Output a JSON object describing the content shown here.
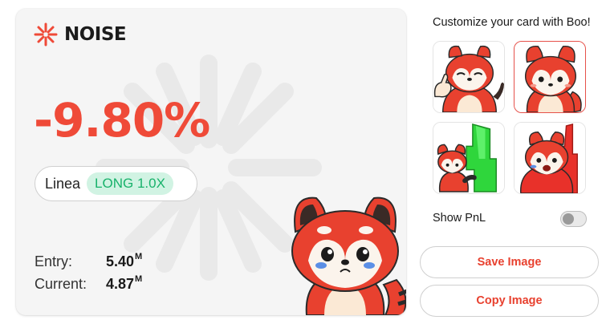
{
  "card": {
    "brand": "NOISE",
    "pnl": "-9.80%",
    "pair": "Linea",
    "side": "LONG 1.0X",
    "entry": {
      "label": "Entry:",
      "value": "5.40",
      "unit": "M"
    },
    "current": {
      "label": "Current:",
      "value": "4.87",
      "unit": "M"
    }
  },
  "panel": {
    "title": "Customize your card with Boo!",
    "thumbnails": [
      {
        "icon": "red-panda-thumbs-up",
        "selected": false
      },
      {
        "icon": "red-panda-sitting",
        "selected": true
      },
      {
        "icon": "red-panda-green-candle",
        "selected": false
      },
      {
        "icon": "red-panda-red-candle",
        "selected": false
      }
    ],
    "show_pnl_label": "Show PnL",
    "show_pnl": false,
    "save_label": "Save Image",
    "copy_label": "Copy Image"
  },
  "colors": {
    "accent": "#e8412f",
    "loss": "#ef4a38",
    "long_badge_bg": "#d1f3e3",
    "long_badge_text": "#18b26b"
  }
}
